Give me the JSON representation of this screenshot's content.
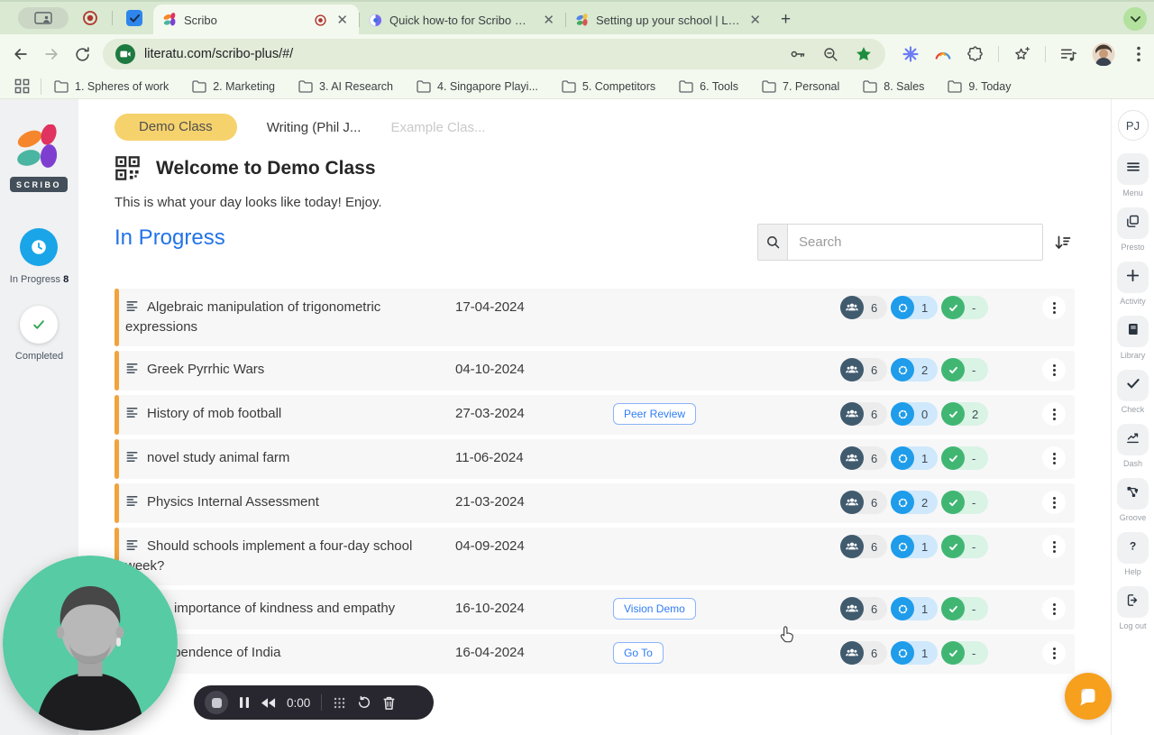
{
  "browser": {
    "tabs": [
      {
        "title": "Scribo",
        "active": true,
        "recording": true
      },
      {
        "title": "Quick how-to for Scribo Conn",
        "active": false
      },
      {
        "title": "Setting up your school | Liter",
        "active": false
      }
    ],
    "url": "literatu.com/scribo-plus/#/",
    "bookmarks": [
      "1. Spheres of work",
      "2. Marketing",
      "3. AI Research",
      "4. Singapore Playi...",
      "5. Competitors",
      "6. Tools",
      "7. Personal",
      "8. Sales",
      "9. Today"
    ]
  },
  "sidebar_left": {
    "brand": "SCRIBO",
    "in_progress_label": "In Progress",
    "in_progress_count": "8",
    "completed_label": "Completed"
  },
  "header": {
    "class_tabs": [
      "Demo Class",
      "Writing (Phil J...",
      "Example Clas..."
    ],
    "title": "Welcome to Demo Class",
    "subtitle": "This is what your day looks like today! Enjoy."
  },
  "main": {
    "section_title": "In Progress",
    "search_placeholder": "Search",
    "rows": [
      {
        "title": "Algebraic manipulation of trigonometric expressions",
        "date": "17-04-2024",
        "action": null,
        "students": "6",
        "in_progress": "1",
        "completed": "-"
      },
      {
        "title": "Greek Pyrrhic Wars",
        "date": "04-10-2024",
        "action": null,
        "students": "6",
        "in_progress": "2",
        "completed": "-"
      },
      {
        "title": "History of mob football",
        "date": "27-03-2024",
        "action": "Peer Review",
        "students": "6",
        "in_progress": "0",
        "completed": "2"
      },
      {
        "title": "novel study animal farm",
        "date": "11-06-2024",
        "action": null,
        "students": "6",
        "in_progress": "1",
        "completed": "-"
      },
      {
        "title": "Physics Internal Assessment",
        "date": "21-03-2024",
        "action": null,
        "students": "6",
        "in_progress": "2",
        "completed": "-"
      },
      {
        "title": "Should schools implement a four-day school week?",
        "date": "04-09-2024",
        "action": null,
        "students": "6",
        "in_progress": "1",
        "completed": "-"
      },
      {
        "title": "The importance of kindness and empathy",
        "date": "16-10-2024",
        "action": "Vision Demo",
        "students": "6",
        "in_progress": "1",
        "completed": "-"
      },
      {
        "title": "Independence of India",
        "date": "16-04-2024",
        "action": "Go To",
        "students": "6",
        "in_progress": "1",
        "completed": "-"
      }
    ]
  },
  "sidebar_right": {
    "avatar": "PJ",
    "items": [
      "Menu",
      "Presto",
      "Activity",
      "Library",
      "Check",
      "Dash",
      "Groove",
      "Help",
      "Log out"
    ]
  },
  "recorder": {
    "time": "0:00"
  },
  "colors": {
    "accent_blue": "#2273e8",
    "class_pill_yellow": "#f6d26d",
    "row_accent_orange": "#f1a33c",
    "badge_slate": "#405a6e",
    "badge_blue": "#1f9cea",
    "badge_green": "#41b673",
    "webcam_teal": "#57cba3",
    "chat_orange": "#f6a01e",
    "chrome_green": "#d9e9d2"
  }
}
